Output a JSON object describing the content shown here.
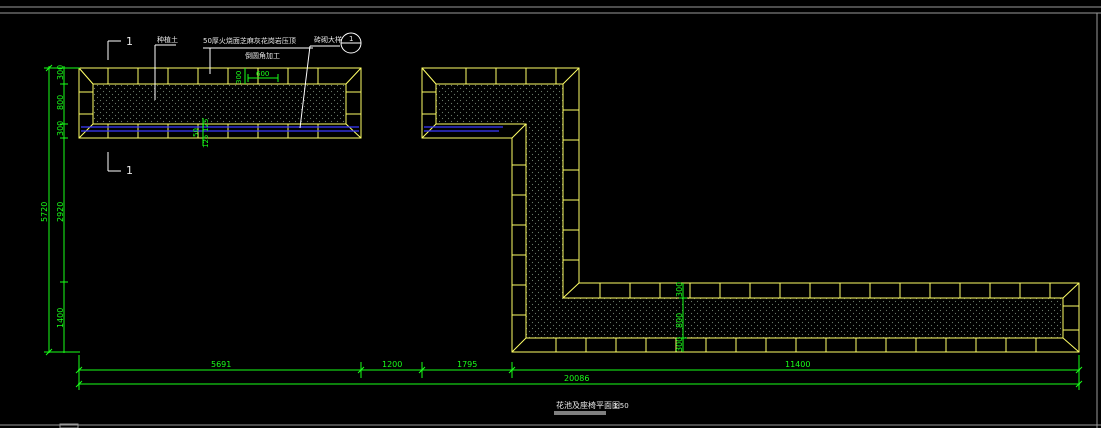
{
  "drawing": {
    "title": "花池及座椅平面图",
    "scale": "1:50",
    "colors": {
      "background": "#000000",
      "outline": "#ffff66",
      "dimension": "#19ff19",
      "leader": "#ffffff",
      "drainage": "#3b3bff"
    },
    "labels": {
      "soil": "种植土",
      "coping_line1": "50厚火烧面芝麻灰花岗岩压顶",
      "coping_line2": "倒圆角加工",
      "plinth": "砖砌大样",
      "section_number": "1",
      "detail_number": "1"
    },
    "dimensions": {
      "coping_width": "600",
      "top_300": "300",
      "top_800": "800",
      "top_300b": "300",
      "small_50": "50",
      "small_125a": "125",
      "small_125b": "125",
      "left_total": "5720",
      "left_2920": "2920",
      "left_1400": "1400",
      "right_300a": "300",
      "right_800": "800",
      "right_300b": "300",
      "bottom_5691": "5691",
      "bottom_1200": "1200",
      "bottom_1795": "1795",
      "bottom_11400": "11400",
      "bottom_total": "20086"
    }
  }
}
